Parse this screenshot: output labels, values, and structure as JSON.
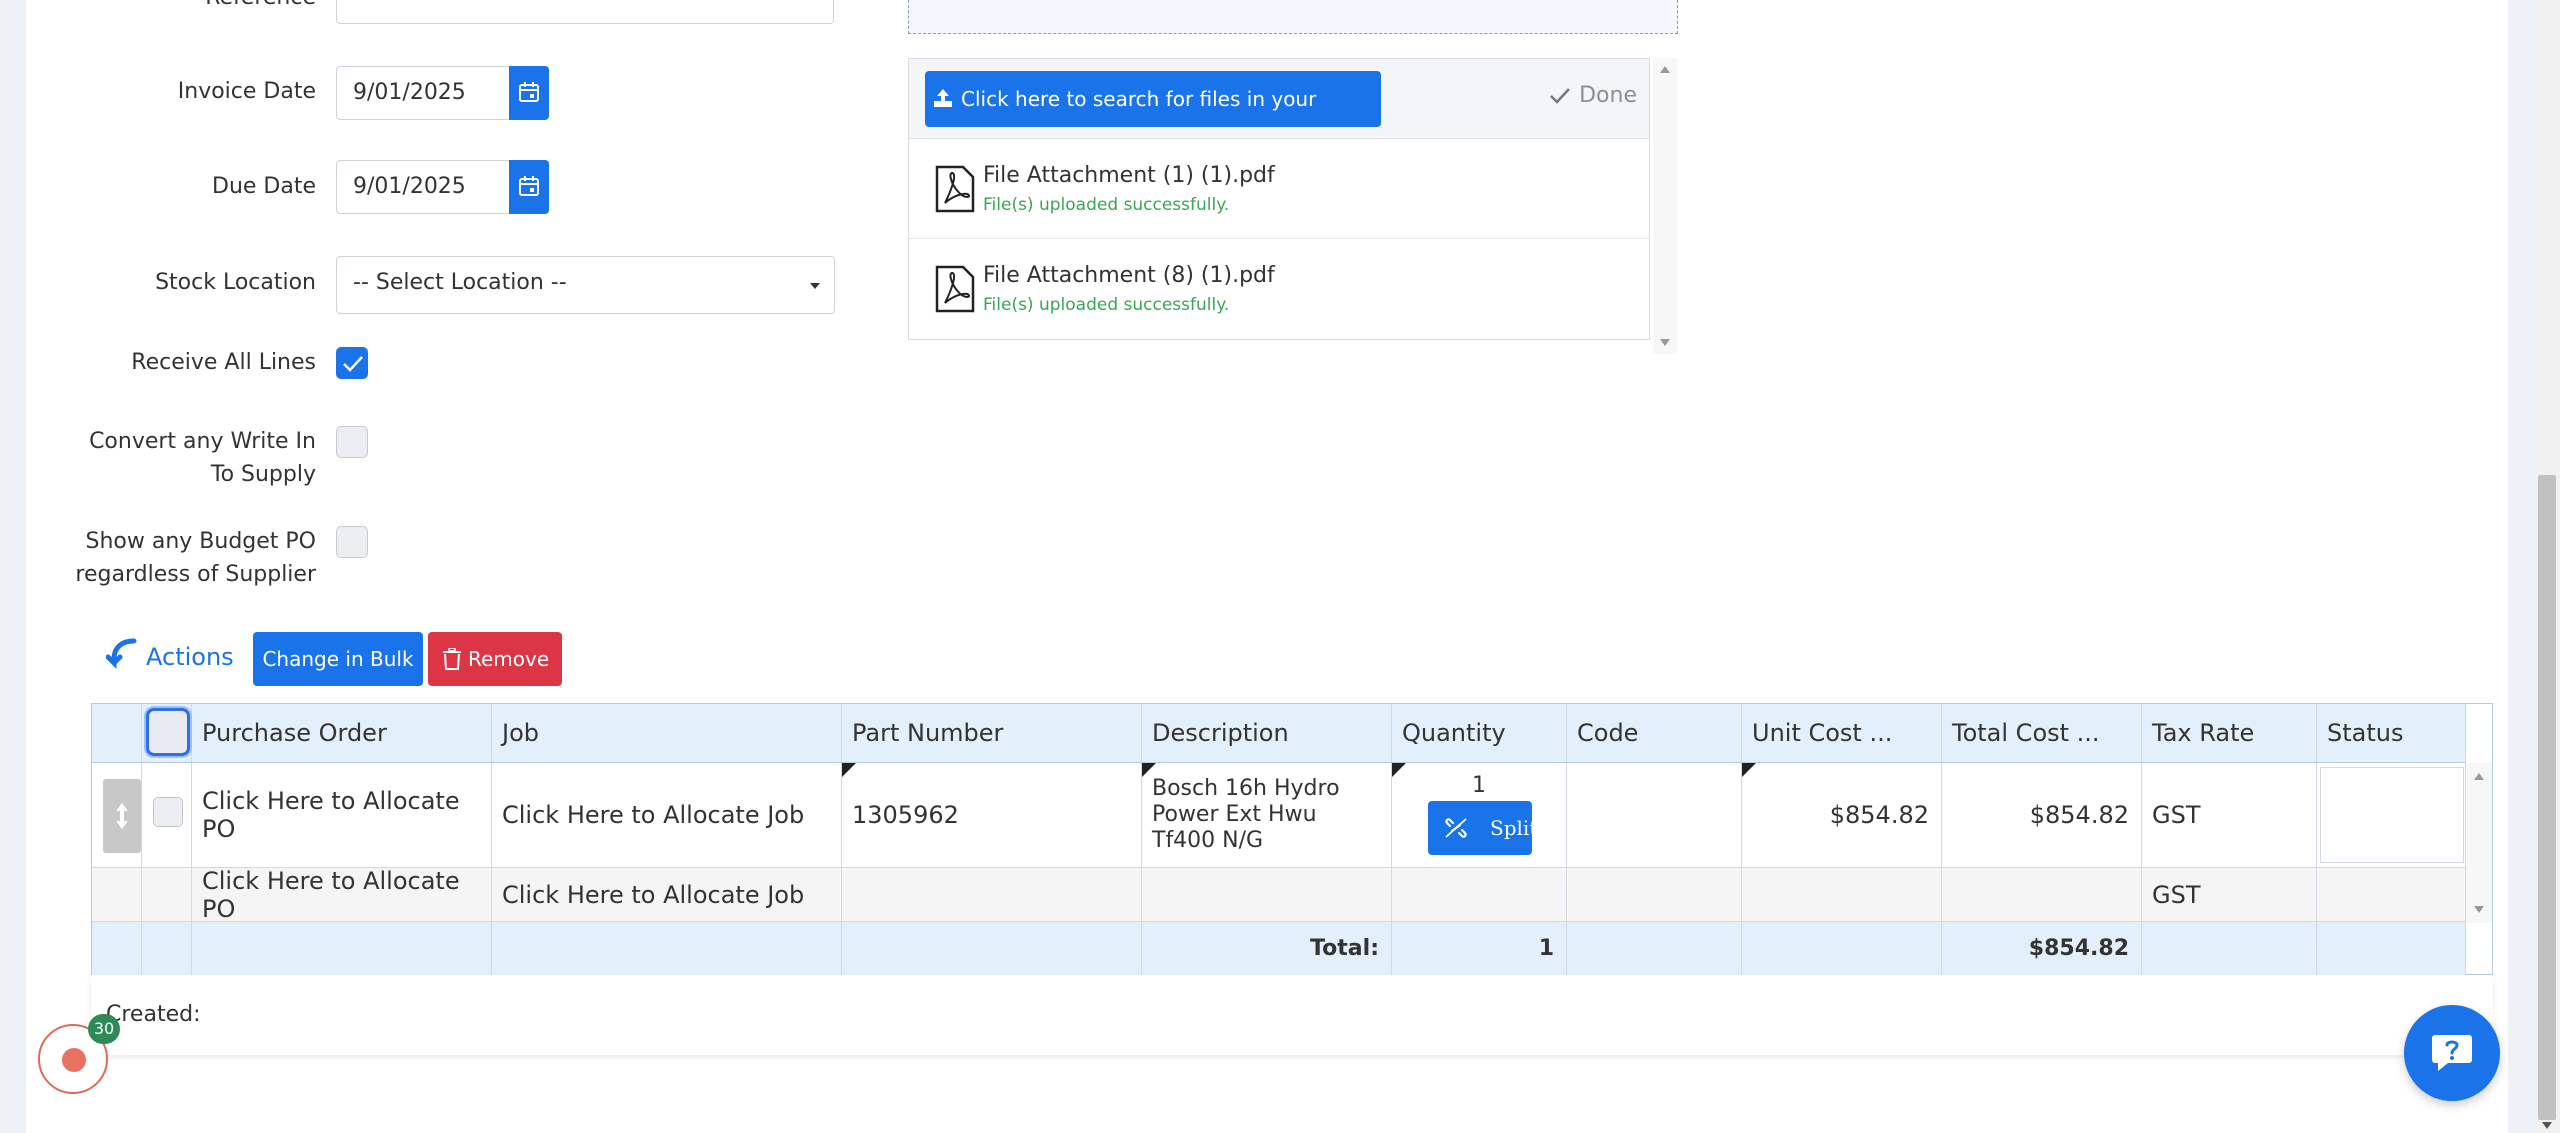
{
  "form": {
    "reference_label": "Reference",
    "invoice_date_label": "Invoice Date",
    "invoice_date_value": "9/01/2025",
    "due_date_label": "Due Date",
    "due_date_value": "9/01/2025",
    "stock_location_label": "Stock Location",
    "stock_location_value": "-- Select Location --",
    "receive_all_label": "Receive All Lines",
    "convert_label_1": "Convert any Write In",
    "convert_label_2": "To Supply",
    "budget_label_1": "Show any Budget PO",
    "budget_label_2": "regardless of Supplier"
  },
  "upload": {
    "button_label": "Click here to search for files in your computer",
    "done_label": "Done",
    "files": [
      {
        "name": "File Attachment (1) (1).pdf",
        "status": "File(s) uploaded successfully."
      },
      {
        "name": "File Attachment (8) (1).pdf",
        "status": "File(s) uploaded successfully."
      }
    ]
  },
  "toolbar": {
    "actions_label": "Actions",
    "bulk_label": "Change in Bulk",
    "remove_label": "Remove"
  },
  "grid": {
    "columns": [
      "Purchase Order",
      "Job",
      "Part Number",
      "Description",
      "Quantity",
      "Code",
      "Unit Cost ...",
      "Total Cost ...",
      "Tax Rate",
      "Status"
    ],
    "rows": [
      {
        "purchase_order": "Click Here to Allocate PO",
        "job": "Click Here to Allocate Job",
        "part_number": "1305962",
        "description_1": "Bosch 16h Hydro",
        "description_2": "Power Ext Hwu",
        "description_3": "Tf400 N/G",
        "quantity": "1",
        "split_label": "Split",
        "code": "",
        "unit_cost": "$854.82",
        "total_cost": "$854.82",
        "tax_rate": "GST",
        "status": ""
      },
      {
        "purchase_order": "Click Here to Allocate PO",
        "job": "Click Here to Allocate Job",
        "tax_rate": "GST"
      }
    ],
    "totals": {
      "label": "Total:",
      "quantity": "1",
      "total_cost": "$854.82"
    }
  },
  "footer": {
    "created_label": "Created:",
    "badge_count": "30"
  },
  "colors": {
    "primary": "#1a73e8",
    "danger": "#dc3545",
    "success": "#3aa655",
    "grid_header": "#e4effc"
  }
}
